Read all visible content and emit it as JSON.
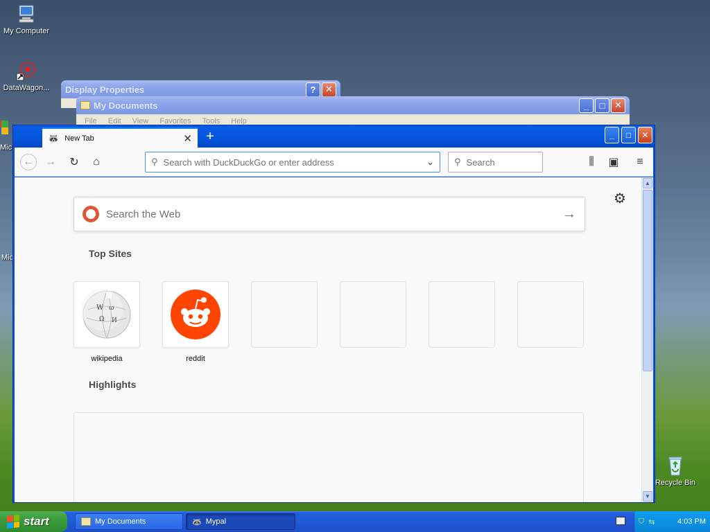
{
  "desktop": {
    "icons": [
      {
        "label": "My Computer"
      },
      {
        "label": "DataWagon..."
      },
      {
        "label": "Recycle Bin"
      }
    ],
    "partial_labels": [
      "Mic",
      "Mic"
    ]
  },
  "background_windows": {
    "display_properties": {
      "title": "Display Properties"
    },
    "my_documents": {
      "title": "My Documents",
      "menu": [
        "File",
        "Edit",
        "View",
        "Favorites",
        "Tools",
        "Help"
      ]
    }
  },
  "browser": {
    "tab": {
      "title": "New Tab"
    },
    "urlbar": {
      "placeholder": "Search with DuckDuckGo or enter address"
    },
    "searchbar": {
      "placeholder": "Search"
    },
    "websearch": {
      "placeholder": "Search the Web"
    },
    "top_sites": {
      "title": "Top Sites",
      "sites": [
        {
          "label": "wikipedia",
          "icon": "wikipedia-globe-icon"
        },
        {
          "label": "reddit",
          "icon": "reddit-alien-icon"
        }
      ]
    },
    "highlights": {
      "title": "Highlights"
    }
  },
  "taskbar": {
    "start_label": "start",
    "tasks": [
      {
        "label": "My Documents"
      },
      {
        "label": "Mypal"
      }
    ],
    "clock": "4:03 PM"
  },
  "colors": {
    "accent": "#0a84ff",
    "xp_blue": "#0a54e0",
    "start_green": "#3c9b3c",
    "reddit": "#ff4500",
    "ddg": "#de5833"
  }
}
